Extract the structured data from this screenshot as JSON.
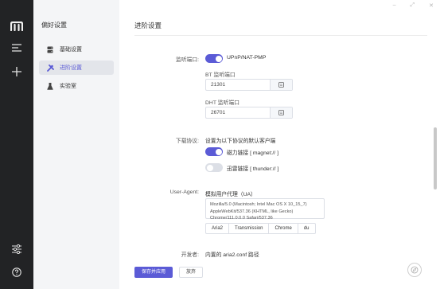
{
  "sidebar": {
    "title": "偏好设置",
    "items": [
      {
        "label": "基础设置",
        "active": false
      },
      {
        "label": "进阶设置",
        "active": true
      },
      {
        "label": "实验室",
        "active": false
      }
    ]
  },
  "page": {
    "title": "进阶设置"
  },
  "listen_port": {
    "label": "监听端口:",
    "upnp_label": "UPnP/NAT-PMP",
    "upnp_enabled": true,
    "bt_label": "BT 监听端口",
    "bt_value": "21301",
    "dht_label": "DHT 监听端口",
    "dht_value": "26701"
  },
  "download_protocol": {
    "label": "下载协议:",
    "description": "设置为以下协议的默认客户端",
    "magnet_label": "磁力链接 [ magnet:// ]",
    "magnet_enabled": true,
    "thunder_label": "迅雷链接 [ thunder:// ]",
    "thunder_enabled": false
  },
  "user_agent": {
    "label": "User-Agent:",
    "title": "模拟用户代理（UA）",
    "value": "Mozilla/5.0 (Macintosh; Intel Mac OS X 10_15_7) AppleWebKit/537.36 (KHTML, like Gecko) Chrome/111.0.0.0 Safari/537.36",
    "presets": [
      "Aria2",
      "Transmission",
      "Chrome",
      "du"
    ]
  },
  "developer": {
    "label": "开发者:",
    "value": "内置的 aria2.conf 路径"
  },
  "actions": {
    "save": "保存并应用",
    "discard": "放弃"
  },
  "colors": {
    "accent": "#5b5bd6",
    "rail": "#222325",
    "sidebar": "#f4f5f7"
  }
}
